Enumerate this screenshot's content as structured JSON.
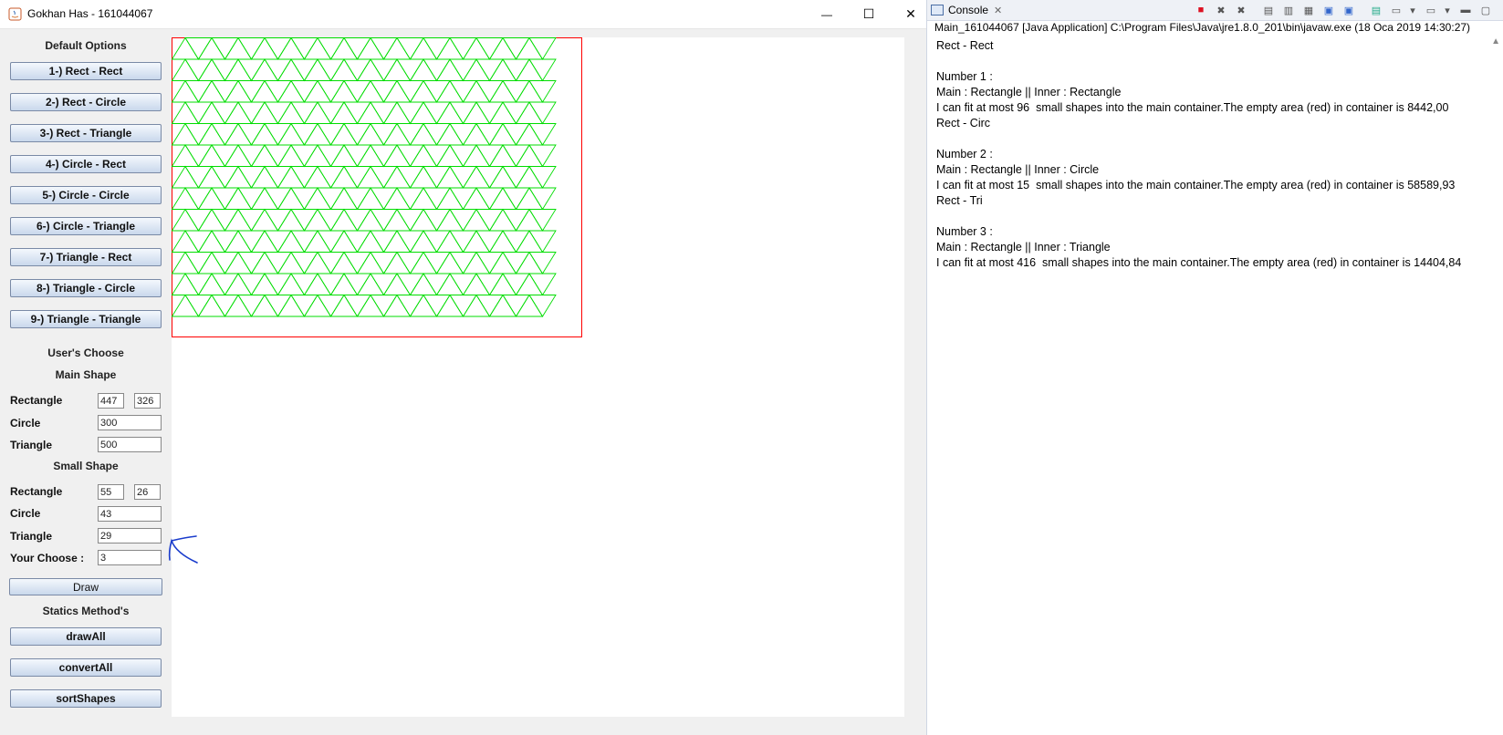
{
  "window": {
    "title": "Gokhan Has - 161044067",
    "minimize_glyph": "—",
    "maximize_glyph": "☐",
    "close_glyph": "✕"
  },
  "left_panel": {
    "default_options_heading": "Default Options",
    "default_buttons": [
      "1-) Rect - Rect",
      "2-) Rect - Circle",
      "3-) Rect - Triangle",
      "4-) Circle - Rect",
      "5-) Circle - Circle",
      "6-) Circle - Triangle",
      "7-) Triangle - Rect",
      "8-) Triangle - Circle",
      "9-) Triangle - Triangle"
    ],
    "users_choose_heading": "User's Choose",
    "main_shape_heading": "Main Shape",
    "main_shape": {
      "rectangle_label": "Rectangle",
      "rectangle_width": "447",
      "rectangle_height": "326",
      "circle_label": "Circle",
      "circle_value": "300",
      "triangle_label": "Triangle",
      "triangle_value": "500"
    },
    "small_shape_heading": "Small Shape",
    "small_shape": {
      "rectangle_label": "Rectangle",
      "rectangle_width": "55",
      "rectangle_height": "26",
      "circle_label": "Circle",
      "circle_value": "43",
      "triangle_label": "Triangle",
      "triangle_value": "29"
    },
    "your_choose_label": "Your Choose :",
    "your_choose_value": "3",
    "draw_button": "Draw",
    "statics_heading": "Statics Method's",
    "static_buttons": [
      "drawAll",
      "convertAll",
      "sortShapes"
    ]
  },
  "canvas": {
    "background": "#ffffff",
    "container_border_color": "#ff0000",
    "triangle_stroke_color": "#00dd00",
    "annotation_color": "#1a3ccc"
  },
  "console": {
    "tab_label": "Console",
    "tab_close": "✕",
    "path_line": "Main_161044067 [Java Application] C:\\Program Files\\Java\\jre1.8.0_201\\bin\\javaw.exe (18 Oca 2019 14:30:27)",
    "output_lines": [
      "Rect - Rect",
      "",
      "Number 1 :",
      "Main : Rectangle || Inner : Rectangle",
      "I can fit at most 96  small shapes into the main container.The empty area (red) in container is 8442,00",
      "Rect - Circ",
      "",
      "Number 2 :",
      "Main : Rectangle || Inner : Circle",
      "I can fit at most 15  small shapes into the main container.The empty area (red) in container is 58589,93",
      "Rect - Tri",
      "",
      "Number 3 :",
      "Main : Rectangle || Inner : Triangle",
      "I can fit at most 416  small shapes into the main container.The empty area (red) in container is 14404,84"
    ],
    "scroll_glyph": "▲"
  }
}
